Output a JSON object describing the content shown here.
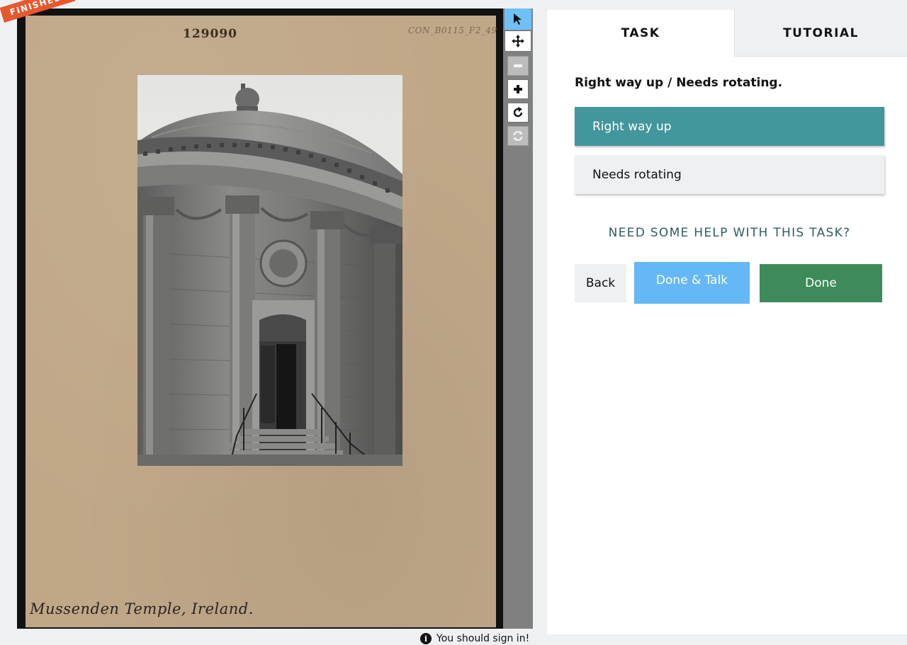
{
  "viewer": {
    "ribbon": "FINISHED!",
    "card_number": "129090",
    "card_ref": "CON_B0115_F2_49",
    "card_caption": "Mussenden Temple, Ireland."
  },
  "toolbar": {
    "tools": [
      {
        "name": "pointer-icon",
        "state": "active"
      },
      {
        "name": "move-icon",
        "state": "enabled"
      },
      {
        "name": "zoom-out-icon",
        "state": "disabled"
      },
      {
        "name": "zoom-in-icon",
        "state": "enabled"
      },
      {
        "name": "rotate-icon",
        "state": "enabled"
      },
      {
        "name": "reset-icon",
        "state": "disabled"
      }
    ]
  },
  "signin_notice": "You should sign in!",
  "panel": {
    "tabs": [
      {
        "label": "TASK",
        "active": true
      },
      {
        "label": "TUTORIAL",
        "active": false
      }
    ],
    "question": "Right way up / Needs rotating.",
    "answers": [
      {
        "label": "Right way up",
        "selected": true
      },
      {
        "label": "Needs rotating",
        "selected": false
      }
    ],
    "help_link": "NEED SOME HELP WITH THIS TASK?",
    "buttons": {
      "back": "Back",
      "done_talk": "Done & Talk",
      "done": "Done"
    }
  },
  "colors": {
    "accent_teal": "#43969b",
    "done_green": "#3d8b5a",
    "talk_blue": "#64b8f5",
    "ribbon_orange": "#e8572e",
    "card_tan": "#c0a788"
  }
}
